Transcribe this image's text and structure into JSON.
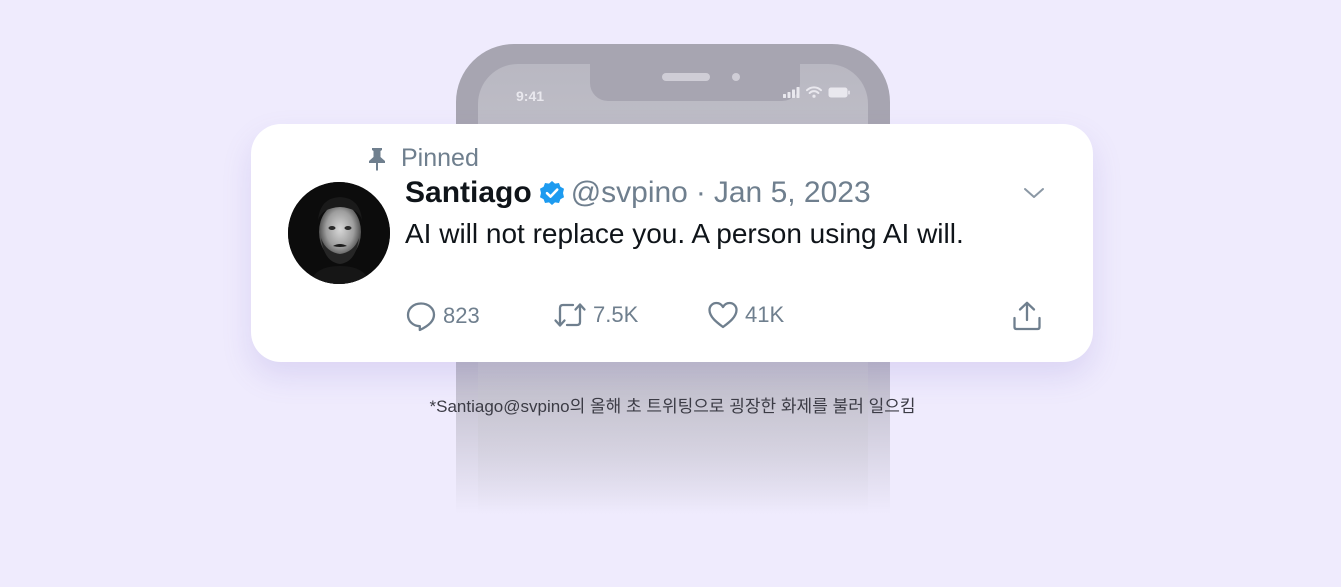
{
  "phone": {
    "status_time": "9:41"
  },
  "tweet": {
    "pinned_label": "Pinned",
    "author_name": "Santiago",
    "handle": "@svpino",
    "separator": "·",
    "date": "Jan 5, 2023",
    "text": "AI will not replace you. A person using AI will.",
    "stats": {
      "replies": "823",
      "retweets": "7.5K",
      "likes": "41K"
    },
    "verified_color": "#1d9bf0"
  },
  "caption": "*Santiago@svpino의 올해 초 트위팅으로 굉장한 화제를 불러 일으킴",
  "colors": {
    "background": "#efebfd",
    "muted_text": "#6f7f8e",
    "primary_text": "#0f1419"
  },
  "icons": [
    "pin-icon",
    "verified-badge-icon",
    "chevron-down-icon",
    "reply-icon",
    "retweet-icon",
    "like-icon",
    "share-icon",
    "cellular-signal-icon",
    "wifi-icon",
    "battery-icon"
  ]
}
